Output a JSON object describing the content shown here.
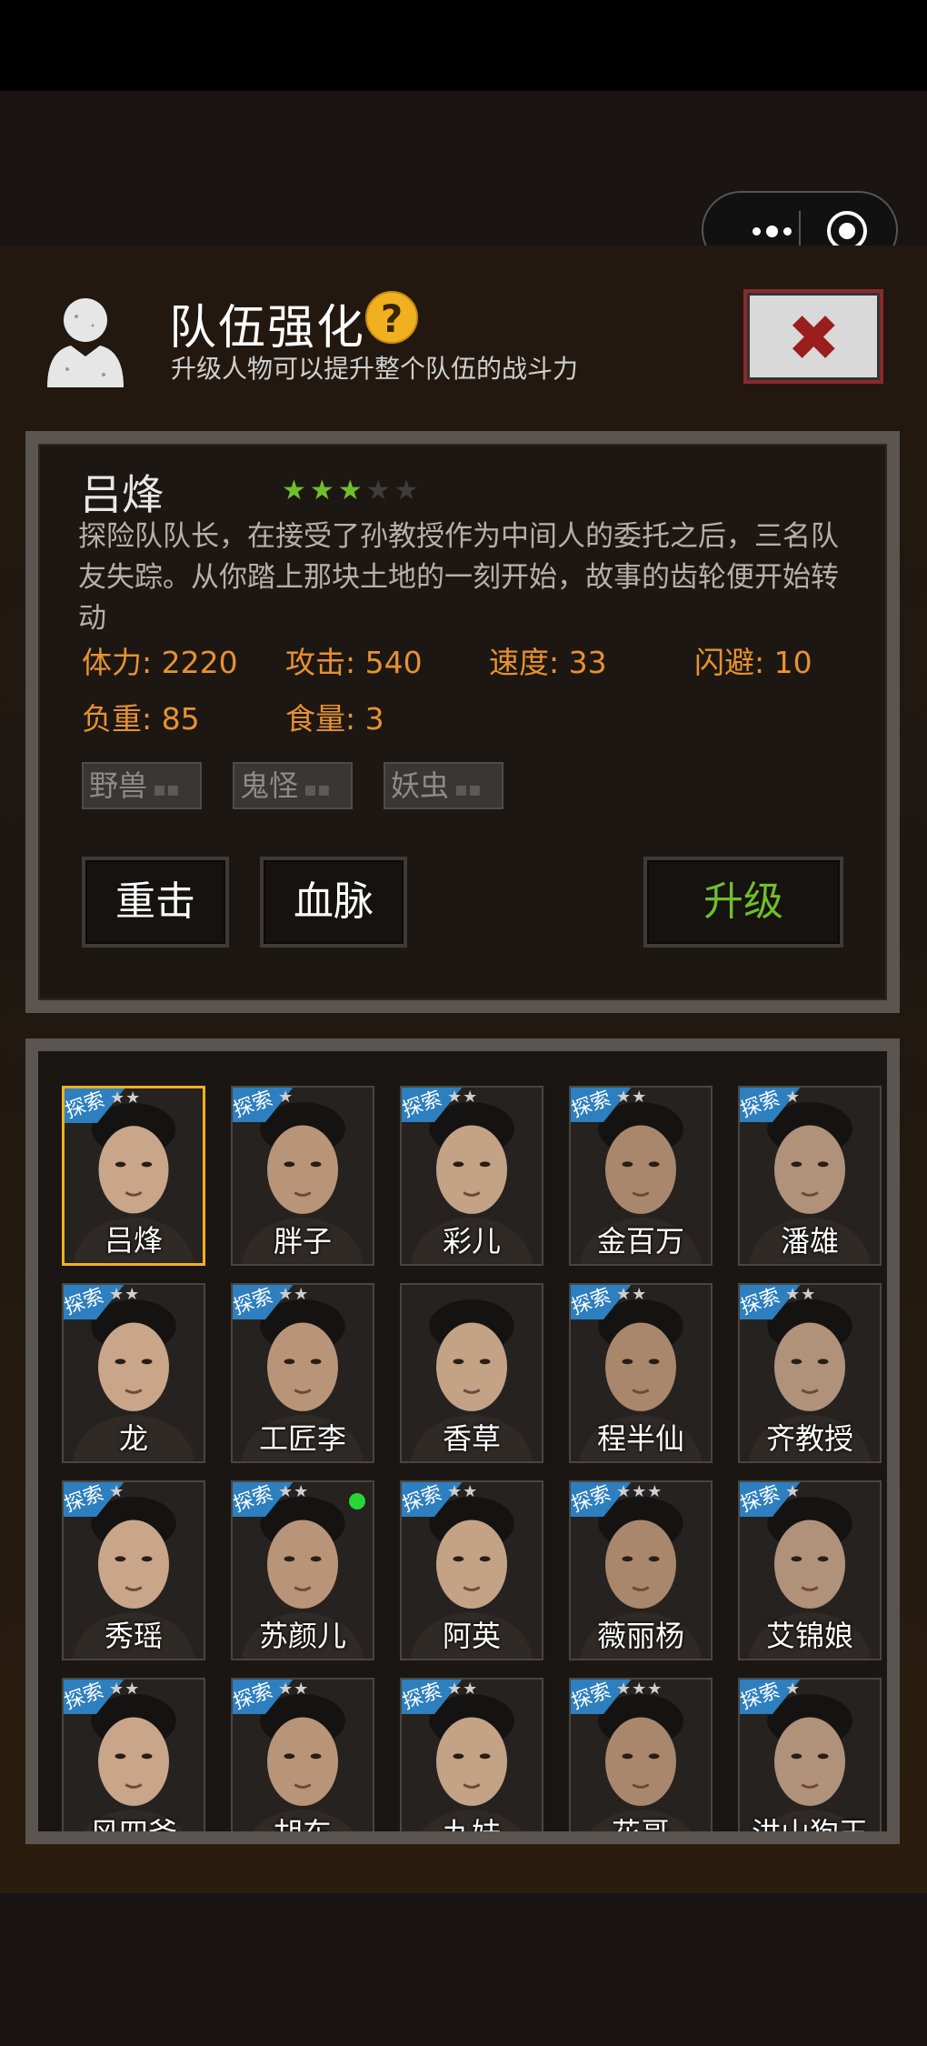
{
  "window": {
    "title": "队伍强化",
    "subtitle": "升级人物可以提升整个队伍的战斗力"
  },
  "header": {
    "help_icon": "?"
  },
  "character": {
    "name": "吕烽",
    "stars_filled": 3,
    "stars_total": 5,
    "description": "探险队队长，在接受了孙教授作为中间人的委托之后，三名队友失踪。从你踏上那块土地的一刻开始，故事的齿轮便开始转动",
    "stats": {
      "stamina": "体力: 2220",
      "attack": "攻击: 540",
      "speed": "速度: 33",
      "dodge": "闪避: 10",
      "load": "负重: 85",
      "food": "食量: 3"
    },
    "tags": [
      "野兽",
      "鬼怪",
      "妖虫"
    ],
    "tag_bars": "▪▪",
    "buttons": {
      "skill1": "重击",
      "skill2": "血脉",
      "upgrade": "升级"
    }
  },
  "roster": [
    {
      "name": "吕烽",
      "badge": "探索",
      "stars": "★★",
      "selected": true
    },
    {
      "name": "胖子",
      "badge": "探索",
      "stars": "★"
    },
    {
      "name": "彩儿",
      "badge": "探索",
      "stars": "★★"
    },
    {
      "name": "金百万",
      "badge": "探索",
      "stars": "★★"
    },
    {
      "name": "潘雄",
      "badge": "探索",
      "stars": "★"
    },
    {
      "name": "龙",
      "badge": "探索",
      "stars": "★★"
    },
    {
      "name": "工匠李",
      "badge": "探索",
      "stars": "★★"
    },
    {
      "name": "香草",
      "badge": "",
      "stars": ""
    },
    {
      "name": "程半仙",
      "badge": "探索",
      "stars": "★★"
    },
    {
      "name": "齐教授",
      "badge": "探索",
      "stars": "★★"
    },
    {
      "name": "秀瑶",
      "badge": "探索",
      "stars": "★"
    },
    {
      "name": "苏颜儿",
      "badge": "探索",
      "stars": "★★",
      "online": true
    },
    {
      "name": "阿英",
      "badge": "探索",
      "stars": "★★"
    },
    {
      "name": "薇丽杨",
      "badge": "探索",
      "stars": "★★★"
    },
    {
      "name": "艾锦娘",
      "badge": "探索",
      "stars": "★"
    },
    {
      "name": "风四爷",
      "badge": "探索",
      "stars": "★★"
    },
    {
      "name": "胡东",
      "badge": "探索",
      "stars": "★★"
    },
    {
      "name": "九妹",
      "badge": "探索",
      "stars": "★★"
    },
    {
      "name": "花哥",
      "badge": "探索",
      "stars": "★★★"
    },
    {
      "name": "洪山狗王",
      "badge": "探索",
      "stars": "★"
    }
  ],
  "colors": {
    "accent": "#f0b020",
    "green": "#6fbf2c",
    "stat": "#e79230"
  }
}
